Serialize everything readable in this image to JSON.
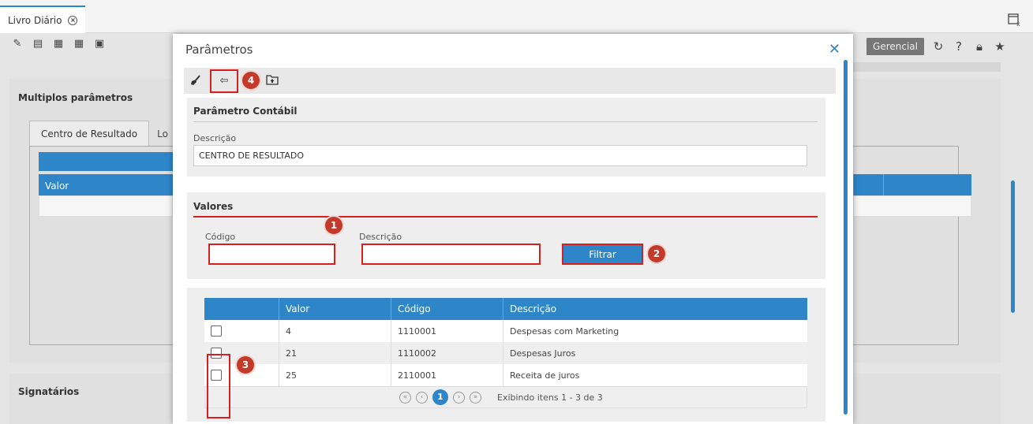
{
  "app": {
    "tab_label": "Livro Diário",
    "gerencial_label": "Gerencial",
    "section_multiplos": "Multiplos parâmetros",
    "tab_centro": "Centro de Resultado",
    "tab_lo": "Lo",
    "header_valor": "Valor",
    "section_signatarios": "Signatários"
  },
  "modal": {
    "title": "Parâmetros",
    "close_icon": "close-icon",
    "section_parametro": "Parâmetro Contábil",
    "descricao_label": "Descrição",
    "descricao_value": "CENTRO DE RESULTADO",
    "section_valores": "Valores",
    "codigo_label": "Código",
    "filter_descricao_label": "Descrição",
    "codigo_value": "",
    "filter_descricao_value": "",
    "filtrar_label": "Filtrar",
    "badges": [
      "1",
      "2",
      "3",
      "4"
    ],
    "grid": {
      "headers": [
        "",
        "Valor",
        "Código",
        "Descrição"
      ],
      "rows": [
        {
          "valor": "4",
          "codigo": "1110001",
          "descricao": "Despesas com Marketing",
          "checked": false
        },
        {
          "valor": "21",
          "codigo": "1110002",
          "descricao": "Despesas Juros",
          "checked": false
        },
        {
          "valor": "25",
          "codigo": "2110001",
          "descricao": "Receita de juros",
          "checked": false
        }
      ],
      "current_page": "1",
      "info": "Exibindo itens 1 - 3 de 3"
    }
  },
  "colors": {
    "accent": "#2e86c9",
    "highlight": "#d62020",
    "badge": "#c43a2a"
  }
}
